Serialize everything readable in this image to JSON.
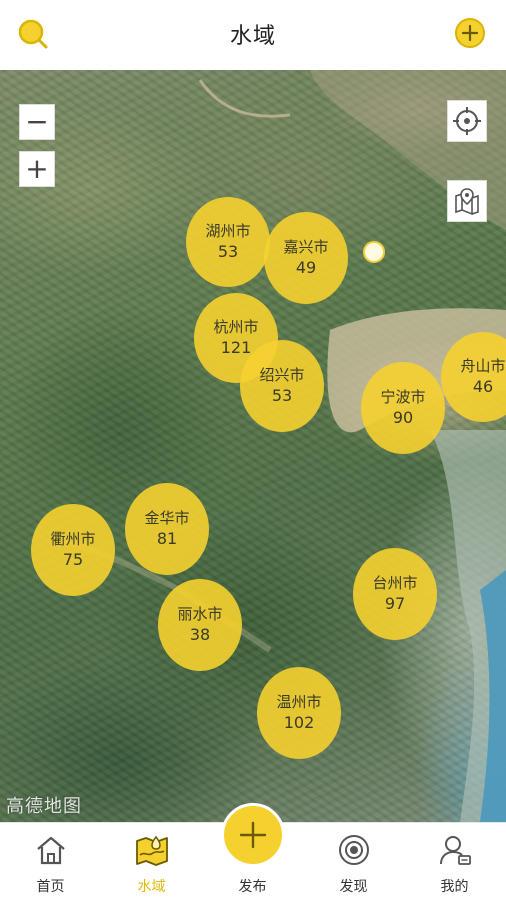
{
  "header": {
    "title": "水域",
    "search_icon": "search-icon",
    "add_icon": "plus-circle-icon"
  },
  "map": {
    "zoom_out_label": "−",
    "zoom_in_label": "+",
    "watermark": "高德地图",
    "accent_color": "#f5d130",
    "clusters": [
      {
        "city": "湖州市",
        "count": "53"
      },
      {
        "city": "嘉兴市",
        "count": "49"
      },
      {
        "city": "杭州市",
        "count": "121"
      },
      {
        "city": "绍兴市",
        "count": "53"
      },
      {
        "city": "舟山市",
        "count": "46"
      },
      {
        "city": "宁波市",
        "count": "90"
      },
      {
        "city": "金华市",
        "count": "81"
      },
      {
        "city": "衢州市",
        "count": "75"
      },
      {
        "city": "台州市",
        "count": "97"
      },
      {
        "city": "丽水市",
        "count": "38"
      },
      {
        "city": "温州市",
        "count": "102"
      }
    ]
  },
  "nav": {
    "items": [
      {
        "label": "首页",
        "icon": "home-icon"
      },
      {
        "label": "水域",
        "icon": "water-map-icon"
      },
      {
        "label": "发布",
        "icon": "plus-icon"
      },
      {
        "label": "发现",
        "icon": "discover-icon"
      },
      {
        "label": "我的",
        "icon": "profile-icon"
      }
    ],
    "active_index": 1
  }
}
